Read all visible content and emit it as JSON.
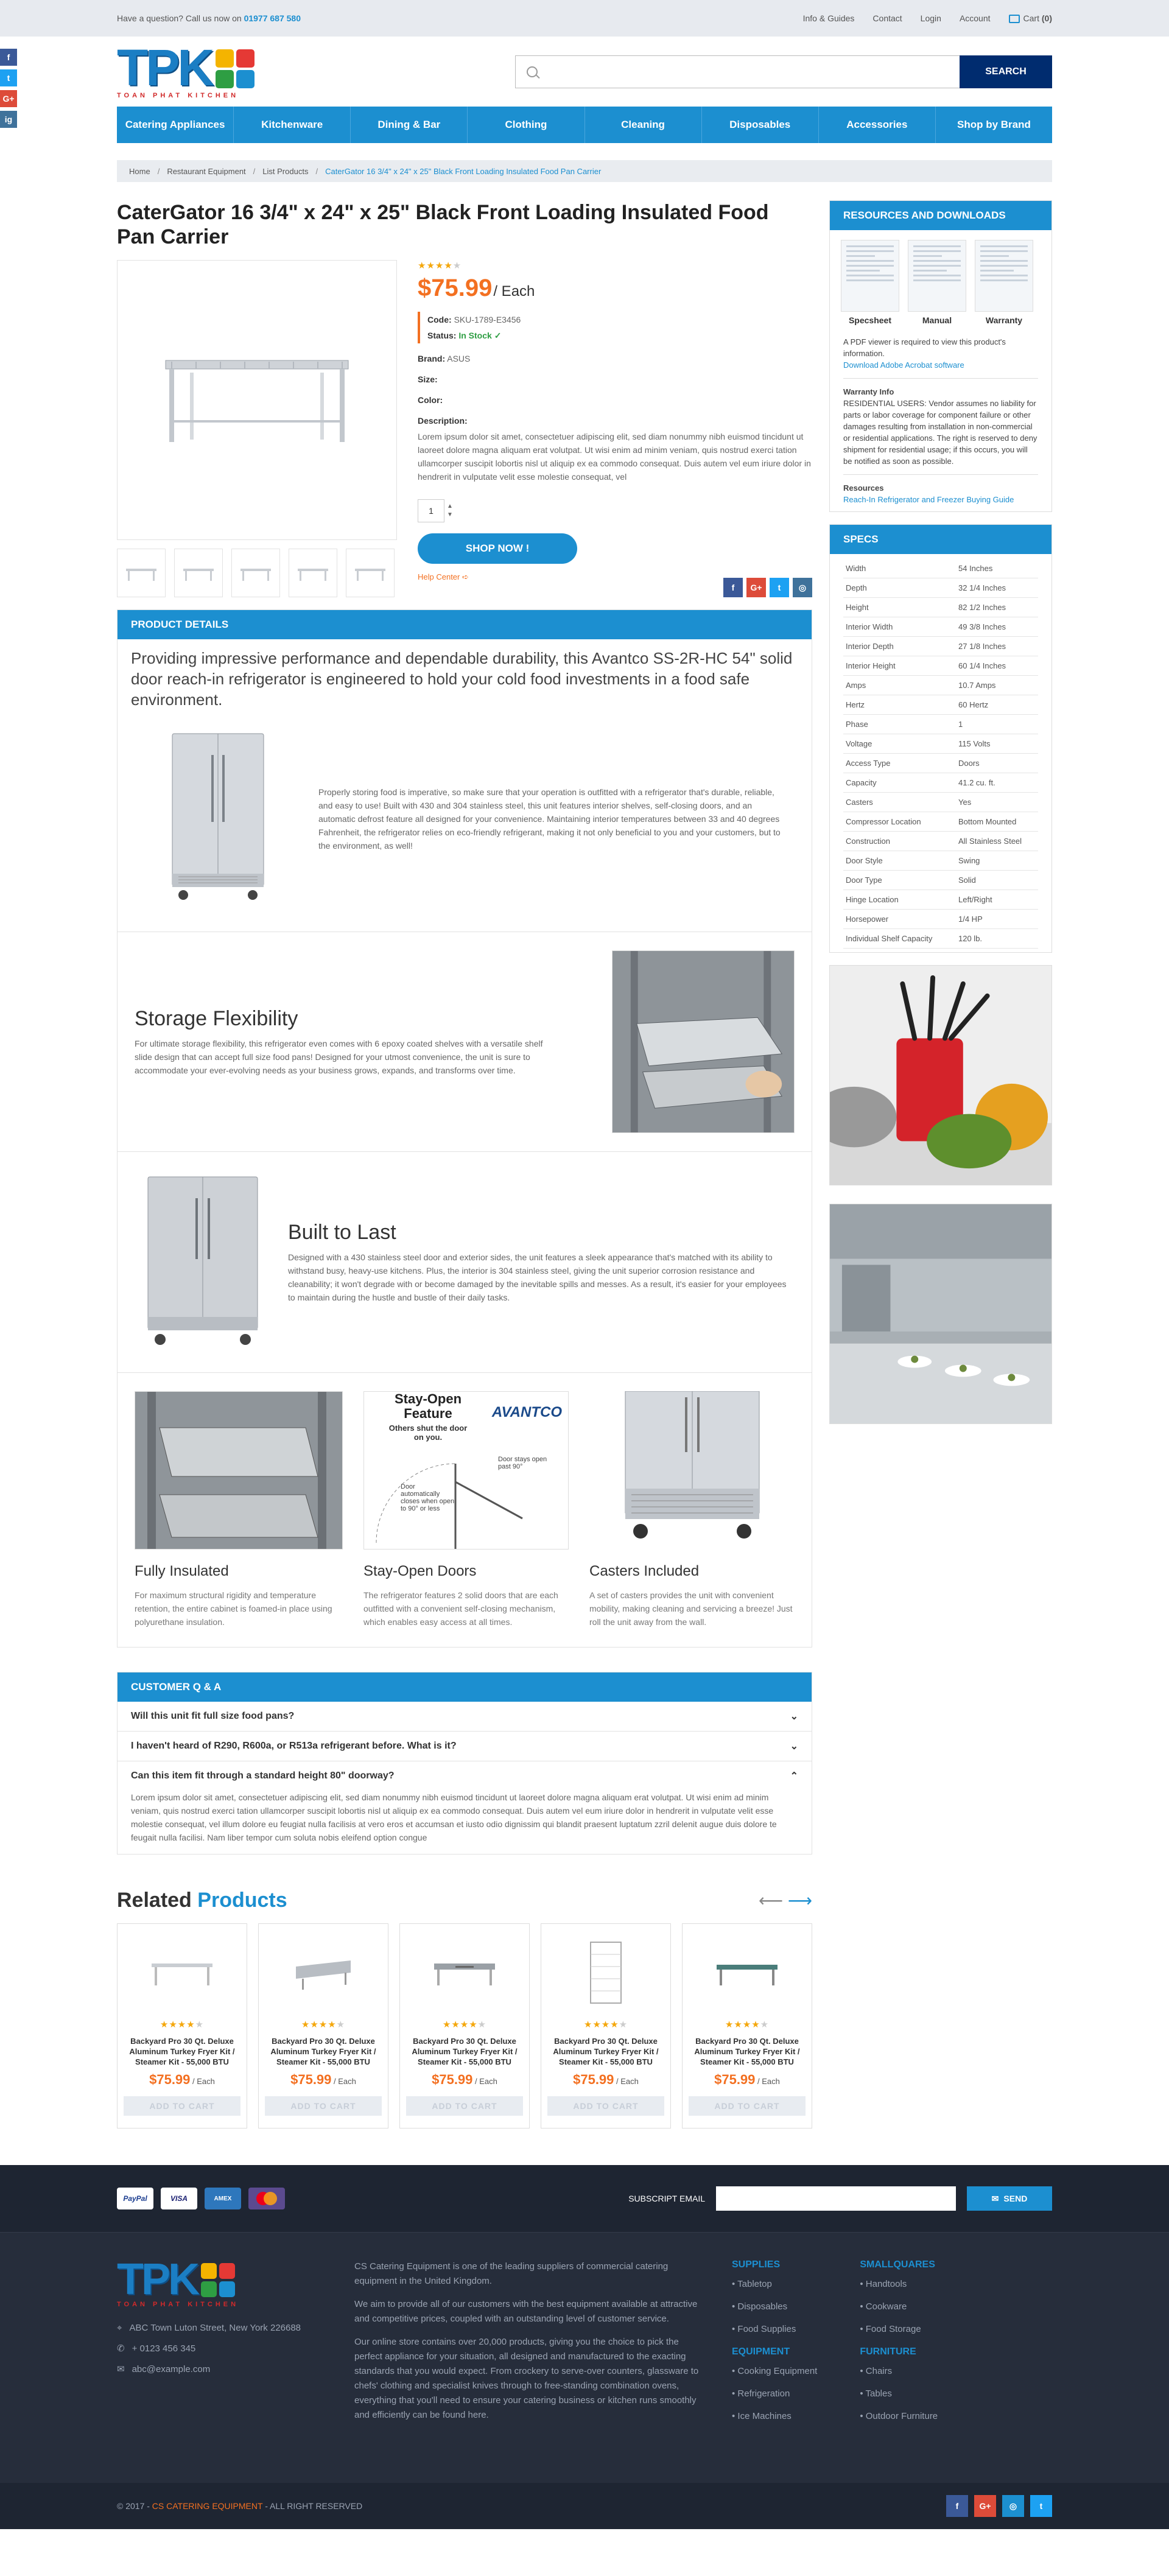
{
  "topbar": {
    "question": "Have a question? Call us now on",
    "phone": "01977 687 580",
    "links": [
      "Info & Guides",
      "Contact",
      "Login",
      "Account"
    ],
    "cart_label": "Cart",
    "cart_count": "(0)"
  },
  "social_side": [
    "f",
    "t",
    "G+",
    "ig"
  ],
  "logo": {
    "text": "TPK",
    "sub": "TOAN PHAT KITCHEN"
  },
  "search": {
    "placeholder": "",
    "button": "SEARCH"
  },
  "nav": [
    "Catering Appliances",
    "Kitchenware",
    "Dining & Bar",
    "Clothing",
    "Cleaning",
    "Disposables",
    "Accessories",
    "Shop by Brand"
  ],
  "breadcrumb": [
    "Home",
    "Restaurant Equipment",
    "List Products",
    "CaterGator 16 3/4\" x 24\" x 25\" Black Front Loading Insulated Food Pan Carrier"
  ],
  "product": {
    "title": "CaterGator 16 3/4\" x 24\" x 25\" Black Front Loading Insulated Food Pan Carrier",
    "rating": 3.5,
    "price": "$75.99",
    "unit": "/ Each",
    "code_label": "Code:",
    "code": "SKU-1789-E3456",
    "status_label": "Status:",
    "status": "In Stock",
    "brand_label": "Brand:",
    "brand": "ASUS",
    "size_label": "Size:",
    "color_label": "Color:",
    "desc_label": "Description:",
    "description": "Lorem ipsum dolor sit amet, consectetuer adipiscing elit, sed diam nonummy nibh euismod tincidunt ut laoreet dolore magna aliquam erat volutpat. Ut wisi enim ad minim veniam, quis nostrud exerci tation ullamcorper suscipit lobortis nisl ut aliquip ex ea commodo consequat. Duis autem vel eum iriure dolor in hendrerit in vulputate velit esse molestie consequat, vel",
    "qty": "1",
    "buy_button": "SHOP NOW !",
    "help": "Help Center"
  },
  "details": {
    "heading": "PRODUCT DETAILS",
    "lead": "Providing impressive performance and dependable durability, this Avantco SS-2R-HC 54\" solid door reach-in refrigerator is engineered to hold your cold food investments in a food safe environment.",
    "intro": "Properly storing food is imperative, so make sure that your operation is outfitted with a refrigerator that's durable, reliable, and easy to use! Built with 430 and 304 stainless steel, this unit features interior shelves, self-closing doors, and an automatic defrost feature all designed for your convenience. Maintaining interior temperatures between 33 and 40 degrees Fahrenheit, the refrigerator relies on eco-friendly refrigerant, making it not only beneficial to you and your customers, but to the environment, as well!",
    "storage_title": "Storage Flexibility",
    "storage_text": "For ultimate storage flexibility, this refrigerator even comes with 6 epoxy coated shelves with a versatile shelf slide design that can accept full size food pans! Designed for your utmost convenience, the unit is sure to accommodate your ever-evolving needs as your business grows, expands, and transforms over time.",
    "built_title": "Built to Last",
    "built_text": "Designed with a 430 stainless steel door and exterior sides, the unit features a sleek appearance that's matched with its ability to withstand busy, heavy-use kitchens. Plus, the interior is 304 stainless steel, giving the unit superior corrosion resistance and cleanability; it won't degrade with or become damaged by the inevitable spills and messes. As a result, it's easier for your employees to maintain during the hustle and bustle of their daily tasks.",
    "cols": [
      {
        "title": "Fully Insulated",
        "text": "For maximum structural rigidity and temperature retention, the entire cabinet is foamed-in place using polyurethane insulation."
      },
      {
        "title": "Stay-Open Doors",
        "text": "The refrigerator features 2 solid doors that are each outfitted with a convenient self-closing mechanism, which enables easy access at all times."
      },
      {
        "title": "Casters Included",
        "text": "A set of casters provides the unit with convenient mobility, making cleaning and servicing a breeze! Just roll the unit away from the wall."
      }
    ],
    "stayopen_img": {
      "title": "Stay-Open Feature",
      "sub": "Others shut the door on you.",
      "brand": "AVANTCO",
      "note1": "Door automatically closes when open to 90° or less",
      "note2": "Door stays open past 90°"
    }
  },
  "qa": {
    "heading": "CUSTOMER Q & A",
    "items": [
      "Will this unit fit full size food pans?",
      "I haven't heard of R290, R600a, or R513a refrigerant before. What is it?",
      "Can this item fit through a standard height 80\" doorway?"
    ],
    "answer": "Lorem ipsum dolor sit amet, consectetuer adipiscing elit, sed diam nonummy nibh euismod tincidunt ut laoreet dolore magna aliquam erat volutpat. Ut wisi enim ad minim veniam, quis nostrud exerci tation ullamcorper suscipit lobortis nisl ut aliquip ex ea commodo consequat. Duis autem vel eum iriure dolor in hendrerit in vulputate velit esse molestie consequat, vel illum dolore eu feugiat nulla facilisis at vero eros et accumsan et iusto odio dignissim qui blandit praesent luptatum zzril delenit augue duis dolore te feugait nulla facilisi. Nam liber tempor cum soluta nobis eleifend option congue"
  },
  "related": {
    "title_a": "Related",
    "title_b": "Products",
    "items": [
      {
        "title": "Backyard Pro 30 Qt. Deluxe Aluminum Turkey Fryer Kit / Steamer Kit - 55,000 BTU",
        "price": "$75.99",
        "unit": "/ Each",
        "cta": "ADD TO CART"
      },
      {
        "title": "Backyard Pro 30 Qt. Deluxe Aluminum Turkey Fryer Kit / Steamer Kit - 55,000 BTU",
        "price": "$75.99",
        "unit": "/ Each",
        "cta": "ADD TO CART"
      },
      {
        "title": "Backyard Pro 30 Qt. Deluxe Aluminum Turkey Fryer Kit / Steamer Kit - 55,000 BTU",
        "price": "$75.99",
        "unit": "/ Each",
        "cta": "ADD TO CART"
      },
      {
        "title": "Backyard Pro 30 Qt. Deluxe Aluminum Turkey Fryer Kit / Steamer Kit - 55,000 BTU",
        "price": "$75.99",
        "unit": "/ Each",
        "cta": "ADD TO CART"
      },
      {
        "title": "Backyard Pro 30 Qt. Deluxe Aluminum Turkey Fryer Kit / Steamer Kit - 55,000 BTU",
        "price": "$75.99",
        "unit": "/ Each",
        "cta": "ADD TO CART"
      }
    ]
  },
  "resources": {
    "heading": "RESOURCES AND DOWNLOADS",
    "docs": [
      "Specsheet",
      "Manual",
      "Warranty"
    ],
    "pdf_note": "A PDF viewer is required to view this product's information.",
    "pdf_link": "Download Adobe Acrobat software",
    "warranty_title": "Warranty Info",
    "warranty_text": "RESIDENTIAL USERS: Vendor assumes no liability for parts or labor coverage for component failure or other damages resulting from installation in non-commercial or residential applications. The right is reserved to deny shipment for residential usage; if this occurs, you will be notified as soon as possible.",
    "res_title": "Resources",
    "res_link": "Reach-In Refrigerator and Freezer Buying Guide"
  },
  "specs": {
    "heading": "SPECS",
    "rows": [
      [
        "Width",
        "54 Inches"
      ],
      [
        "Depth",
        "32 1/4 Inches"
      ],
      [
        "Height",
        "82 1/2 Inches"
      ],
      [
        "Interior Width",
        "49 3/8 Inches"
      ],
      [
        "Interior Depth",
        "27 1/8 Inches"
      ],
      [
        "Interior Height",
        "60 1/4 Inches"
      ],
      [
        "Amps",
        "10.7 Amps"
      ],
      [
        "Hertz",
        "60 Hertz"
      ],
      [
        "Phase",
        "1"
      ],
      [
        "Voltage",
        "115 Volts"
      ],
      [
        "Access Type",
        "Doors"
      ],
      [
        "Capacity",
        "41.2 cu. ft."
      ],
      [
        "Casters",
        "Yes"
      ],
      [
        "Compressor Location",
        "Bottom Mounted"
      ],
      [
        "Construction",
        "All Stainless Steel"
      ],
      [
        "Door Style",
        "Swing"
      ],
      [
        "Door Type",
        "Solid"
      ],
      [
        "Hinge Location",
        "Left/Right"
      ],
      [
        "Horsepower",
        "1/4 HP"
      ],
      [
        "Individual Shelf Capacity",
        "120 lb."
      ]
    ]
  },
  "footer": {
    "payments": [
      "PayPal",
      "VISA",
      "AMEX",
      "MC"
    ],
    "subscribe_label": "SUBSCRIPT EMAIL",
    "send": "SEND",
    "address": "ABC Town Luton Street, New York 226688",
    "phone": "+ 0123 456 345",
    "email": "abc@example.com",
    "about": [
      "CS Catering Equipment is one of the leading suppliers of commercial catering equipment in the United Kingdom.",
      "We aim to provide all of our customers with the best equipment available at attractive and competitive prices, coupled with an outstanding level of customer service.",
      "Our online store contains over 20,000 products, giving you the choice to pick the perfect appliance for your situation, all designed and manufactured to the exacting standards that you would expect. From crockery to serve-over counters, glassware to chefs' clothing and specialist knives through to free-standing combination ovens, everything that you'll need to ensure your catering business or kitchen runs smoothly and efficiently can be found here."
    ],
    "groups": [
      {
        "title": "SUPPLIES",
        "items": [
          "Tabletop",
          "Disposables",
          "Food Supplies"
        ]
      },
      {
        "title": "SMALLQUARES",
        "items": [
          "Handtools",
          "Cookware",
          "Food Storage"
        ]
      },
      {
        "title": "EQUIPMENT",
        "items": [
          "Cooking Equipment",
          "Refrigeration",
          "Ice Machines"
        ]
      },
      {
        "title": "FURNITURE",
        "items": [
          "Chairs",
          "Tables",
          "Outdoor Furniture"
        ]
      }
    ],
    "copy_pre": "© 2017 -",
    "copy_brand": "CS CATERING EQUIPMENT",
    "copy_post": "- ALL RIGHT RESERVED"
  }
}
